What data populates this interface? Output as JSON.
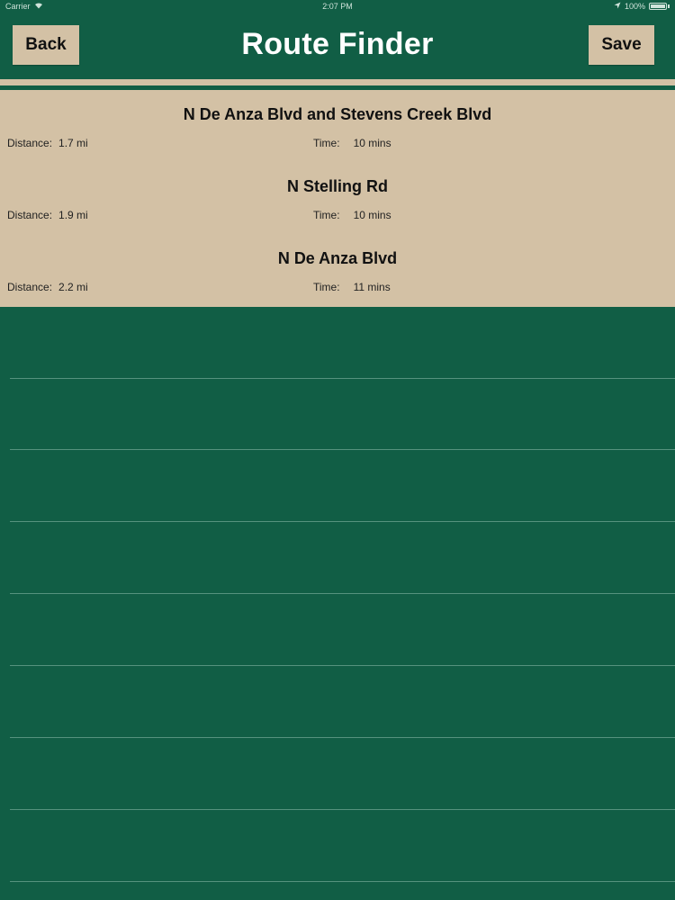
{
  "status_bar": {
    "carrier": "Carrier",
    "time": "2:07 PM",
    "battery": "100%"
  },
  "nav": {
    "back_label": "Back",
    "title": "Route Finder",
    "save_label": "Save"
  },
  "routes": [
    {
      "name": "N De Anza Blvd and Stevens Creek Blvd",
      "distance_label": "Distance:",
      "distance": "1.7 mi",
      "time_label": "Time:",
      "time": "10 mins"
    },
    {
      "name": "N Stelling Rd",
      "distance_label": "Distance:",
      "distance": "1.9 mi",
      "time_label": "Time:",
      "time": "10 mins"
    },
    {
      "name": "N De Anza Blvd",
      "distance_label": "Distance:",
      "distance": "2.2 mi",
      "time_label": "Time:",
      "time": "11 mins"
    }
  ],
  "colors": {
    "background": "#115e45",
    "accent": "#d3c1a5"
  }
}
